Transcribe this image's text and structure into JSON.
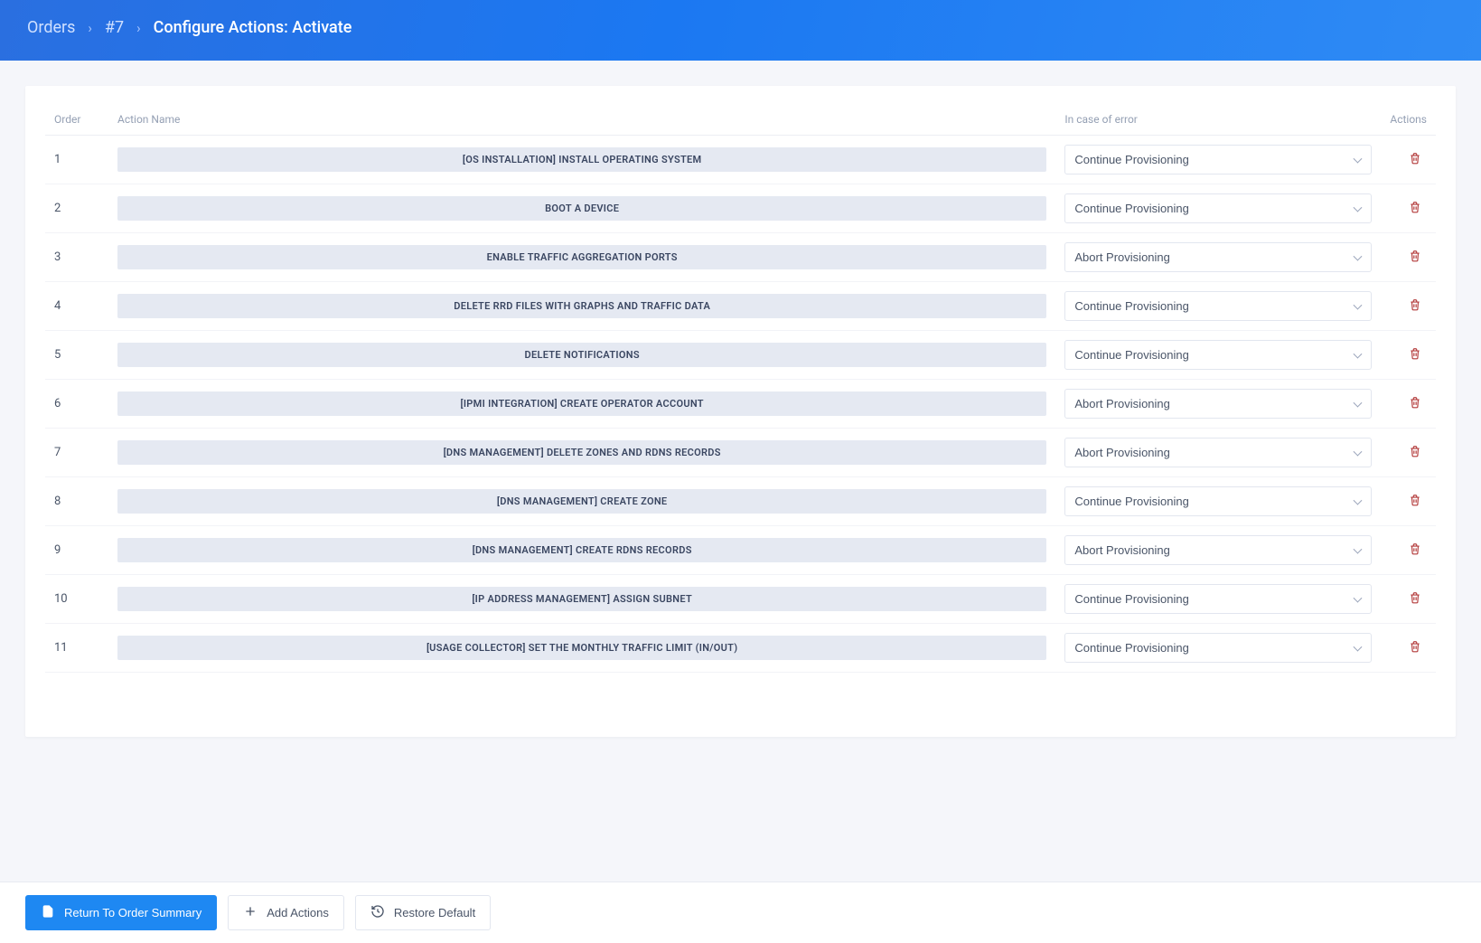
{
  "breadcrumb": {
    "root": "Orders",
    "item": "#7",
    "current": "Configure Actions: Activate"
  },
  "table": {
    "headers": {
      "order": "Order",
      "name": "Action Name",
      "error": "In case of error",
      "actions": "Actions"
    },
    "error_options": [
      "Continue Provisioning",
      "Abort Provisioning"
    ]
  },
  "rows": [
    {
      "order": "1",
      "name": "[OS INSTALLATION] INSTALL OPERATING SYSTEM",
      "on_error": "Continue Provisioning"
    },
    {
      "order": "2",
      "name": "BOOT A DEVICE",
      "on_error": "Continue Provisioning"
    },
    {
      "order": "3",
      "name": "ENABLE TRAFFIC AGGREGATION PORTS",
      "on_error": "Abort Provisioning"
    },
    {
      "order": "4",
      "name": "DELETE RRD FILES WITH GRAPHS AND TRAFFIC DATA",
      "on_error": "Continue Provisioning"
    },
    {
      "order": "5",
      "name": "DELETE NOTIFICATIONS",
      "on_error": "Continue Provisioning"
    },
    {
      "order": "6",
      "name": "[IPMI INTEGRATION] CREATE OPERATOR ACCOUNT",
      "on_error": "Abort Provisioning"
    },
    {
      "order": "7",
      "name": "[DNS MANAGEMENT] DELETE ZONES AND RDNS RECORDS",
      "on_error": "Abort Provisioning"
    },
    {
      "order": "8",
      "name": "[DNS MANAGEMENT] CREATE ZONE",
      "on_error": "Continue Provisioning"
    },
    {
      "order": "9",
      "name": "[DNS MANAGEMENT] CREATE RDNS RECORDS",
      "on_error": "Abort Provisioning"
    },
    {
      "order": "10",
      "name": "[IP ADDRESS MANAGEMENT] ASSIGN SUBNET",
      "on_error": "Continue Provisioning"
    },
    {
      "order": "11",
      "name": "[USAGE COLLECTOR] SET THE MONTHLY TRAFFIC LIMIT (IN/OUT)",
      "on_error": "Continue Provisioning"
    }
  ],
  "footer": {
    "return": "Return To Order Summary",
    "add": "Add Actions",
    "restore": "Restore Default"
  }
}
